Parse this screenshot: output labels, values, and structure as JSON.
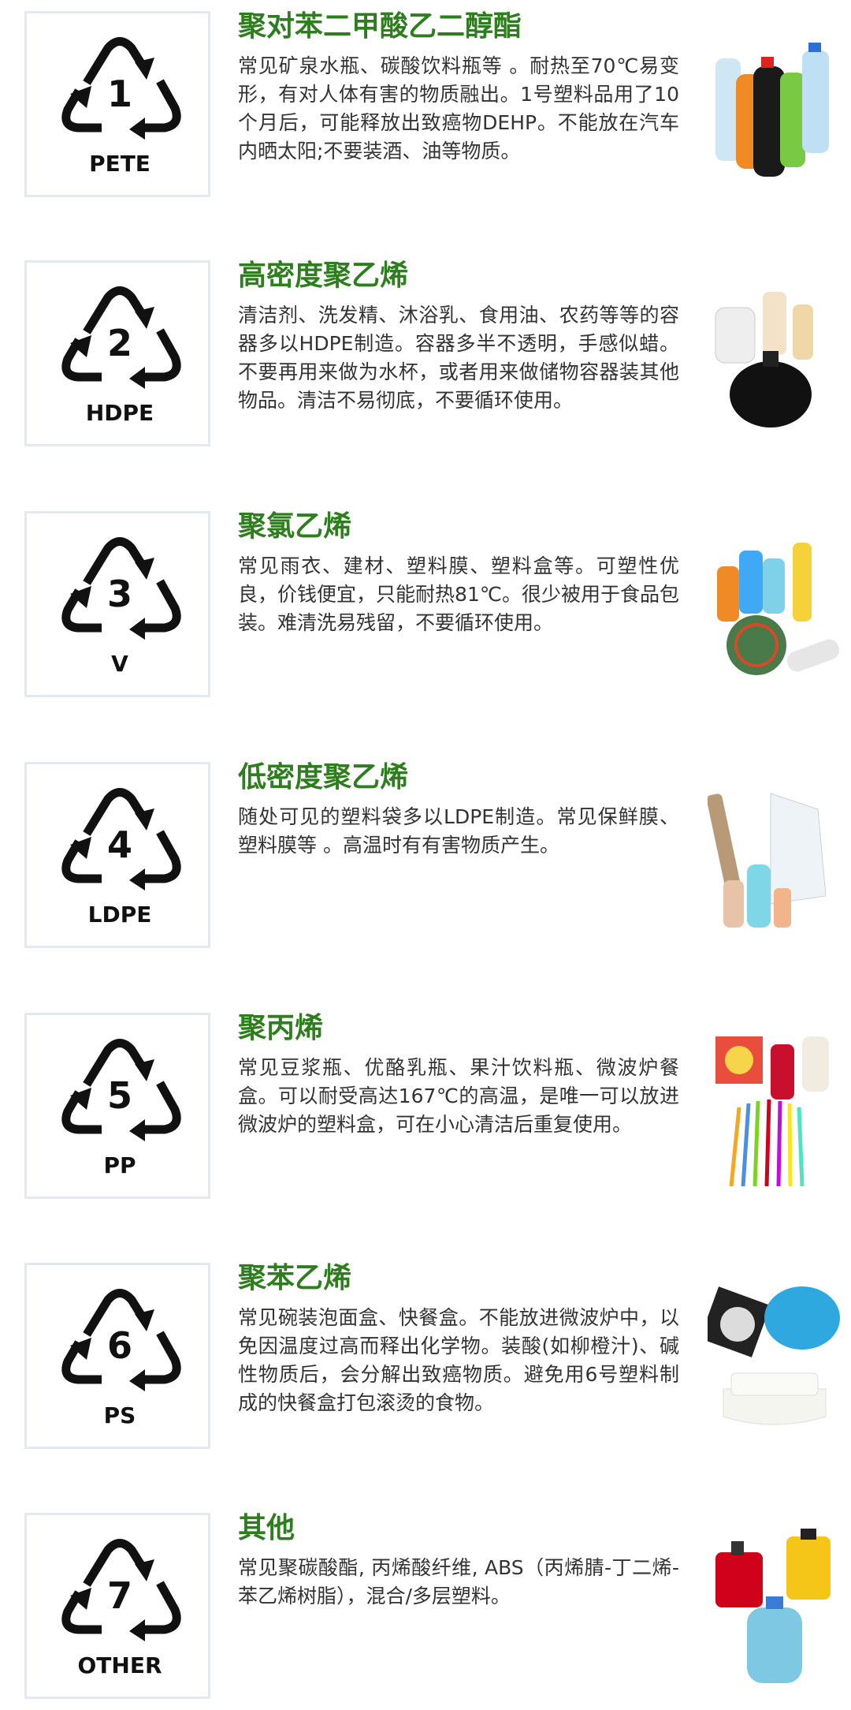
{
  "items": [
    {
      "number": "1",
      "code": "PETE",
      "title": "聚对苯二甲酸乙二醇酯",
      "description": "常见矿泉水瓶、碳酸饮料瓶等 。耐热至70℃易变形，有对人体有害的物质融出。1号塑料品用了10个月后，可能释放出致癌物DEHP。不能放在汽车内晒太阳;不要装酒、油等物质。",
      "image": "plastic-bottles"
    },
    {
      "number": "2",
      "code": "HDPE",
      "title": "高密度聚乙烯",
      "description": "清洁剂、洗发精、沐浴乳、食用油、农药等等的容器多以HDPE制造。容器多半不透明，手感似蜡。不要再用来做为水杯，或者用来做储物容器装其他物品。清洁不易彻底，不要循环使用。",
      "image": "detergent-containers"
    },
    {
      "number": "3",
      "code": "V",
      "title": "聚氯乙烯",
      "description": "常见雨衣、建材、塑料膜、塑料盒等。可塑性优良，价钱便宜，只能耐热81℃。很少被用于食品包装。难清洗易残留，不要循环使用。",
      "image": "pvc-products"
    },
    {
      "number": "4",
      "code": "LDPE",
      "title": "低密度聚乙烯",
      "description": "随处可见的塑料袋多以LDPE制造。常见保鲜膜、塑料膜等 。高温时有有害物质产生。",
      "image": "ldpe-products"
    },
    {
      "number": "5",
      "code": "PP",
      "title": "聚丙烯",
      "description": "常见豆浆瓶、优酪乳瓶、果汁饮料瓶、微波炉餐盒。可以耐受高达167℃的高温，是唯一可以放进微波炉的塑料盒，可在小心清洁后重复使用。",
      "image": "pp-products"
    },
    {
      "number": "6",
      "code": "PS",
      "title": "聚苯乙烯",
      "description": "常见碗装泡面盒、快餐盒。不能放进微波炉中，以免因温度过高而释出化学物。装酸(如柳橙汁)、碱性物质后，会分解出致癌物质。避免用6号塑料制成的快餐盒打包滚烫的食物。",
      "image": "ps-products"
    },
    {
      "number": "7",
      "code": "OTHER",
      "title": "其他",
      "description": "常见聚碳酸酯, 丙烯酸纤维, ABS（丙烯腈-丁二烯-苯乙烯树脂），混合/多层塑料。",
      "image": "other-products"
    }
  ],
  "colors": {
    "title": "#2e7d1e",
    "text": "#333333",
    "border": "#e4e9f1"
  }
}
